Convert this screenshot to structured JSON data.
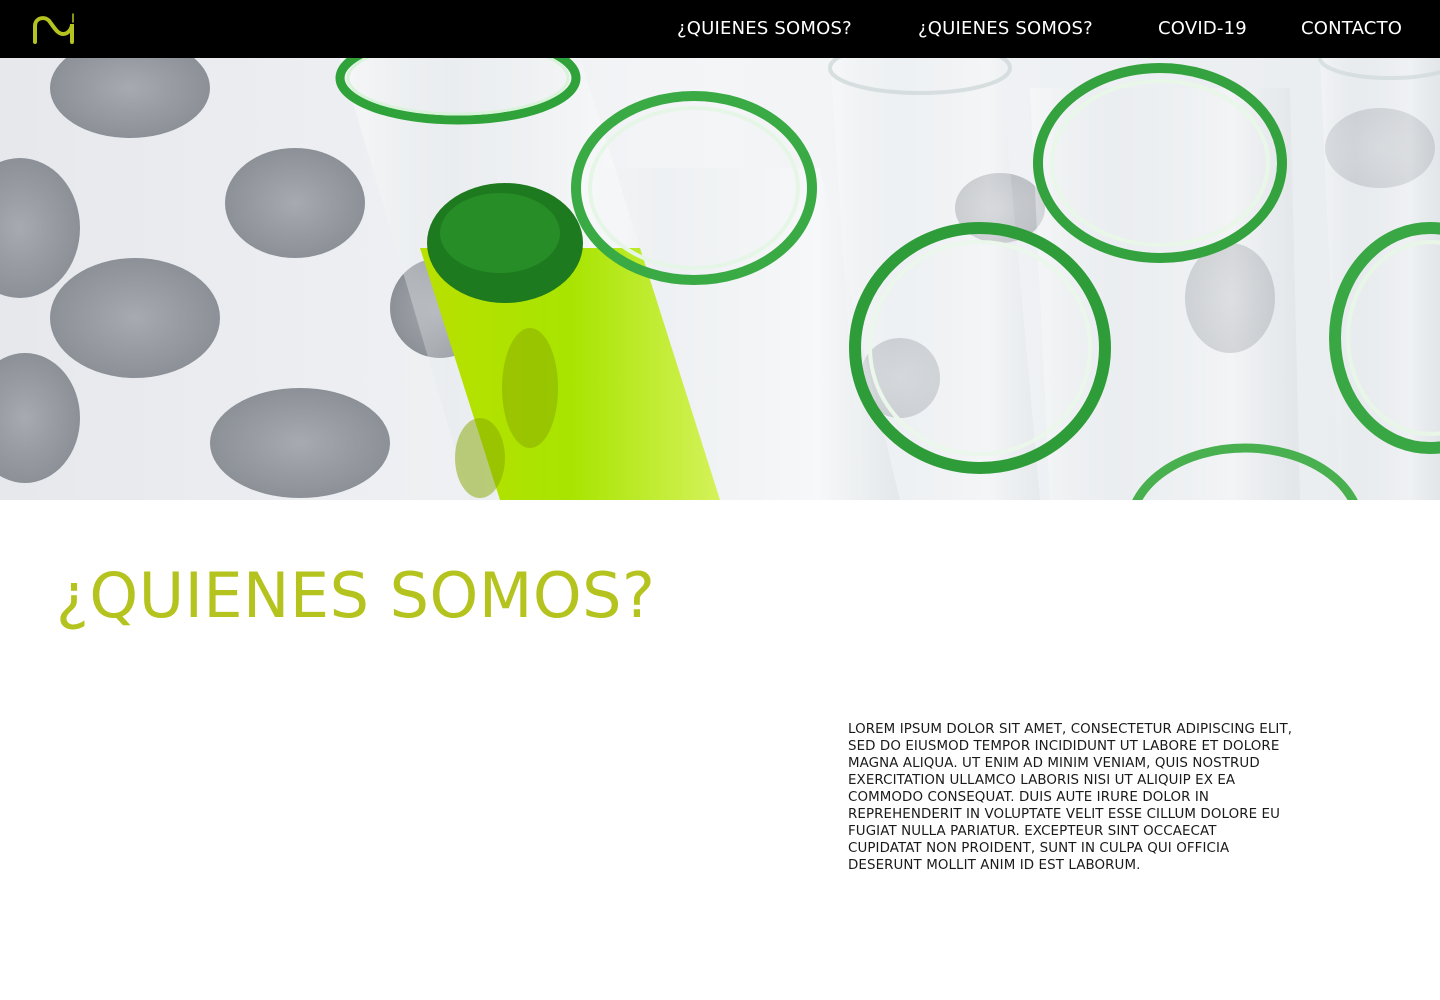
{
  "brand": {
    "logo_icon": "wave-logo-icon",
    "accent_color": "#b5c31e"
  },
  "nav": {
    "items": [
      {
        "label": "¿QUIENES SOMOS?"
      },
      {
        "label": "¿QUIENES SOMOS?"
      },
      {
        "label": "COVID-19"
      },
      {
        "label": "CONTACTO"
      }
    ]
  },
  "hero": {
    "image_subject": "test-tubes-icon"
  },
  "section": {
    "title": "¿QUIENES SOMOS?",
    "body": "LOREM IPSUM DOLOR SIT AMET, CONSECTETUR ADIPISCING ELIT, SED DO EIUSMOD TEMPOR INCIDIDUNT UT LABORE ET DOLORE MAGNA ALIQUA. UT ENIM AD MINIM VENIAM, QUIS NOSTRUD EXERCITATION ULLAMCO LABORIS NISI UT ALIQUIP EX EA COMMODO CONSEQUAT. DUIS AUTE IRURE DOLOR IN REPREHENDERIT IN VOLUPTATE VELIT ESSE CILLUM DOLORE EU FUGIAT NULLA PARIATUR. EXCEPTEUR SINT OCCAECAT CUPIDATAT NON PROIDENT, SUNT IN CULPA QUI OFFICIA DESERUNT MOLLIT ANIM ID EST LABORUM."
  }
}
